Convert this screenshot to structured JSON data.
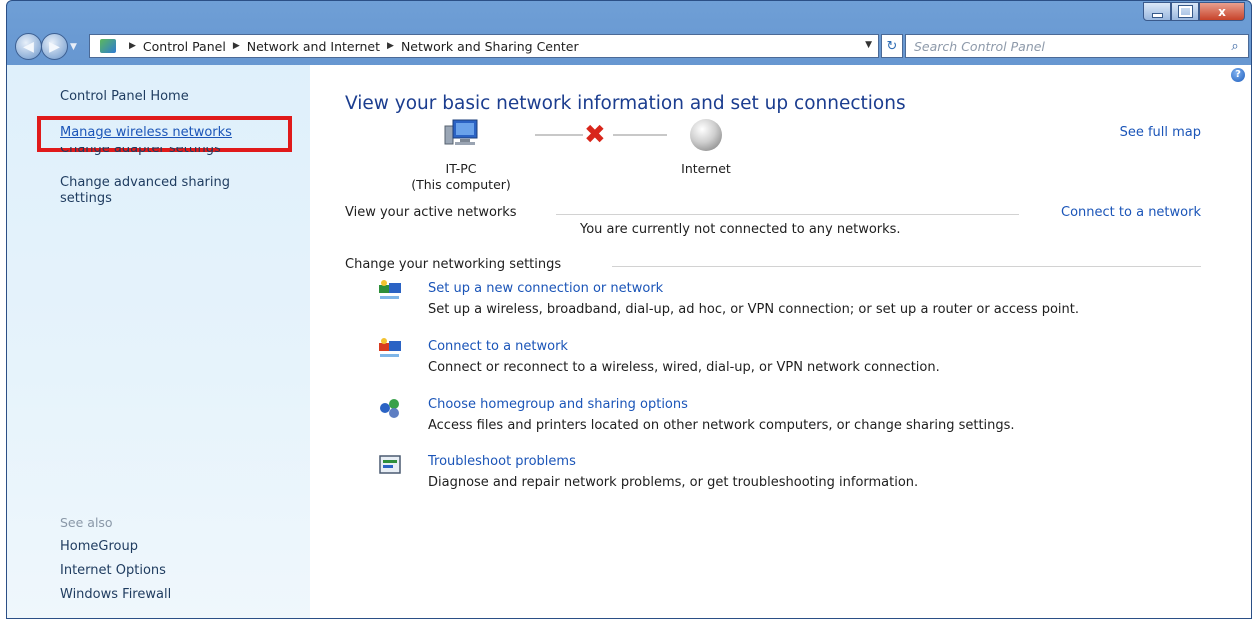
{
  "window": {
    "controls": {
      "minimize_icon": "minimize-icon",
      "maximize_icon": "maximize-icon",
      "close_label": "x"
    }
  },
  "navbar": {
    "breadcrumb": [
      "Control Panel",
      "Network and Internet",
      "Network and Sharing Center"
    ],
    "search_placeholder": "Search Control Panel"
  },
  "sidebar": {
    "home": "Control Panel Home",
    "links": [
      {
        "label": "Manage wireless networks"
      },
      {
        "label": "Change adapter settings"
      },
      {
        "label": "Change advanced sharing"
      },
      {
        "label": "settings"
      }
    ],
    "see_also": {
      "title": "See also",
      "items": [
        {
          "label": "HomeGroup"
        },
        {
          "label": "Internet Options"
        },
        {
          "label": "Windows Firewall"
        }
      ]
    }
  },
  "main": {
    "heading": "View your basic network information and set up connections",
    "see_full_map": "See full map",
    "network_map": {
      "computer_name": "IT-PC",
      "computer_sub": "(This computer)",
      "internet": "Internet",
      "status_icon": "disconnected-x-icon"
    },
    "active_networks": {
      "label": "View your active networks",
      "connect_link": "Connect to a network",
      "status": "You are currently not connected to any networks."
    },
    "settings": {
      "label": "Change your networking settings",
      "tasks": [
        {
          "title": "Set up a new connection or network",
          "desc": "Set up a wireless, broadband, dial-up, ad hoc, or VPN connection; or set up a router or access point.",
          "icon": "new-connection-icon"
        },
        {
          "title": "Connect to a network",
          "desc": "Connect or reconnect to a wireless, wired, dial-up, or VPN network connection.",
          "icon": "connect-network-icon"
        },
        {
          "title": "Choose homegroup and sharing options",
          "desc": "Access files and printers located on other network computers, or change sharing settings.",
          "icon": "homegroup-icon"
        },
        {
          "title": "Troubleshoot problems",
          "desc": "Diagnose and repair network problems, or get troubleshooting information.",
          "icon": "troubleshoot-icon"
        }
      ]
    }
  },
  "colors": {
    "link": "#1b55b8",
    "heading": "#1b3d8f",
    "highlight_box": "#e01a1a",
    "sidebar_bg": "#e2f1fb"
  }
}
